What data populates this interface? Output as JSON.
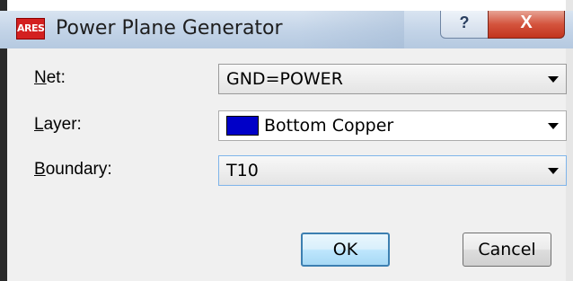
{
  "window": {
    "title": "Power Plane Generator",
    "app_icon_text": "ARES",
    "help_label": "?",
    "close_label": "X"
  },
  "form": {
    "net": {
      "label_key": "N",
      "label_rest": "et:",
      "value": "GND=POWER"
    },
    "layer": {
      "label_key": "L",
      "label_rest": "ayer:",
      "value": "Bottom Copper",
      "swatch_color": "#0000c8"
    },
    "boundary": {
      "label_key": "B",
      "label_rest": "oundary:",
      "value": "T10"
    }
  },
  "buttons": {
    "ok": "OK",
    "cancel": "Cancel"
  },
  "colors": {
    "titlebar": "#c8d7ea",
    "close": "#c8402a",
    "dialog_bg": "#f0f0f0",
    "default_button_border": "#3c7fb1"
  }
}
